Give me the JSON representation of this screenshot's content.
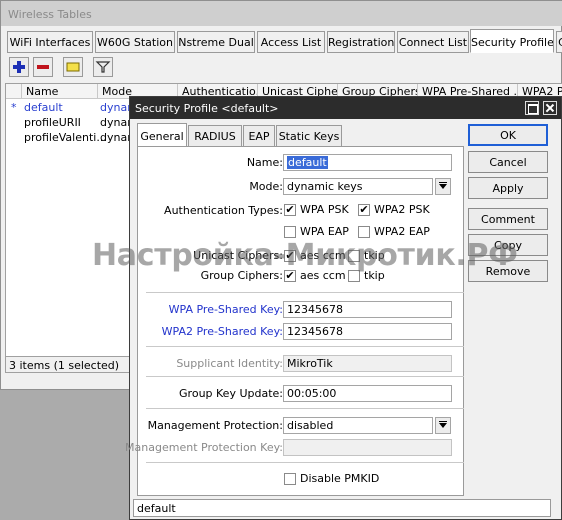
{
  "background_window": {
    "title": "Wireless Tables",
    "tabs": [
      "WiFi Interfaces",
      "W60G Station",
      "Nstreme Dual",
      "Access List",
      "Registration",
      "Connect List",
      "Security Profiles",
      "C"
    ],
    "active_tab": "Security Profiles",
    "toolbar": [
      "add-icon",
      "remove-icon",
      "comment-icon",
      "filter-icon"
    ],
    "columns": [
      "Name",
      "Mode",
      "Authenticatio...",
      "Unicast Ciphers",
      "Group Ciphers",
      "WPA Pre-Shared ...",
      "WPA2 P"
    ],
    "rows": [
      {
        "marker": "*",
        "name": "default",
        "mode": "dynami"
      },
      {
        "marker": "",
        "name": "profileURII",
        "mode": "dynami"
      },
      {
        "marker": "",
        "name": "profileValenti...",
        "mode": "dynami"
      }
    ],
    "status": "3 items (1 selected)"
  },
  "dialog": {
    "title": "Security Profile <default>",
    "tabs": [
      "General",
      "RADIUS",
      "EAP",
      "Static Keys"
    ],
    "active_tab": "General",
    "fields": {
      "name_label": "Name:",
      "name_value": "default",
      "mode_label": "Mode:",
      "mode_value": "dynamic keys",
      "auth_label": "Authentication Types:",
      "auth_options": [
        {
          "label": "WPA PSK",
          "checked": true
        },
        {
          "label": "WPA2 PSK",
          "checked": true
        },
        {
          "label": "WPA EAP",
          "checked": false
        },
        {
          "label": "WPA2 EAP",
          "checked": false
        }
      ],
      "unicast_label": "Unicast Ciphers:",
      "unicast_options": [
        {
          "label": "aes ccm",
          "checked": true
        },
        {
          "label": "tkip",
          "checked": false
        }
      ],
      "group_label": "Group Ciphers:",
      "group_options": [
        {
          "label": "aes ccm",
          "checked": true
        },
        {
          "label": "tkip",
          "checked": false
        }
      ],
      "wpa_psk_label": "WPA Pre-Shared Key:",
      "wpa_psk_value": "12345678",
      "wpa2_psk_label": "WPA2 Pre-Shared Key:",
      "wpa2_psk_value": "12345678",
      "supplicant_label": "Supplicant Identity:",
      "supplicant_value": "MikroTik",
      "group_key_label": "Group Key Update:",
      "group_key_value": "00:05:00",
      "mgmt_label": "Management Protection:",
      "mgmt_value": "disabled",
      "mgmt_key_label": "Management Protection Key:",
      "mgmt_key_value": "",
      "pmkid_label": "Disable PMKID",
      "pmkid_checked": false
    },
    "buttons": {
      "ok": "OK",
      "cancel": "Cancel",
      "apply": "Apply",
      "comment": "Comment",
      "copy": "Copy",
      "remove": "Remove"
    },
    "status": "default"
  },
  "watermark": "Настройка-Микротик.РФ",
  "colors": {
    "accent": "#1f5fd6",
    "link_label": "#2233cc",
    "title_bar": "#2c2c2c",
    "add": "#1c2fb5",
    "remove": "#c0141c"
  }
}
